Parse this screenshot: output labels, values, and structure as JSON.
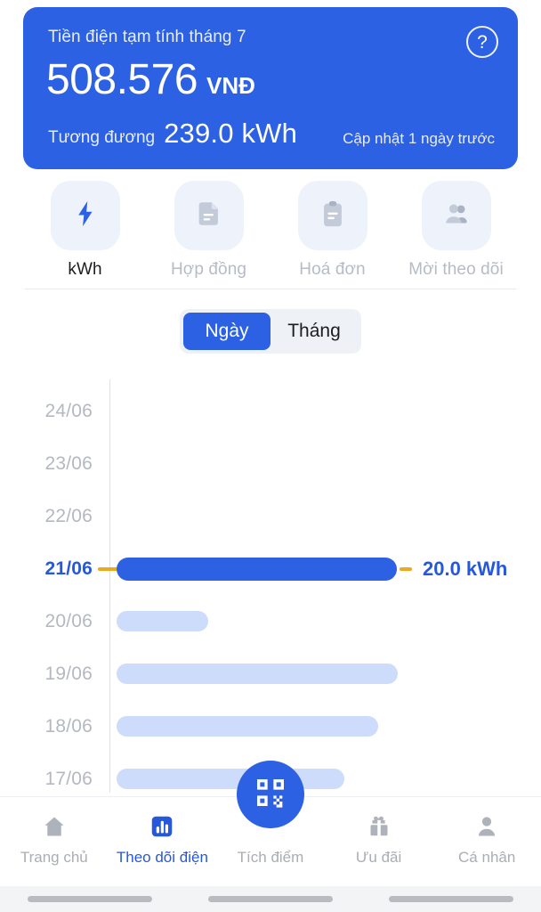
{
  "header": {
    "title": "Tiền điện tạm tính tháng 7",
    "amount": "508.576",
    "currency": "VNĐ",
    "equivalent_label": "Tương đương",
    "equivalent_value": "239.0 kWh",
    "updated": "Cập nhật 1 ngày trước",
    "help_icon": "question-circle-icon",
    "bg_color": "#2c61e4"
  },
  "quick_actions": [
    {
      "label": "kWh",
      "icon": "lightning-bolt-icon",
      "active": true
    },
    {
      "label": "Hợp đồng",
      "icon": "document-icon",
      "active": false
    },
    {
      "label": "Hoá đơn",
      "icon": "clipboard-icon",
      "active": false
    },
    {
      "label": "Mời theo dõi",
      "icon": "people-group-icon",
      "active": false
    }
  ],
  "segmented": {
    "options": [
      "Ngày",
      "Tháng"
    ],
    "selected": "Ngày"
  },
  "chart_data": {
    "type": "bar",
    "orientation": "horizontal",
    "title": "",
    "xlabel": "kWh",
    "ylabel": "",
    "categories": [
      "24/06",
      "23/06",
      "22/06",
      "21/06",
      "20/06",
      "19/06",
      "18/06",
      "17/06"
    ],
    "values": [
      0,
      0,
      0,
      20.0,
      6.9,
      20.1,
      18.7,
      16.3
    ],
    "selected_category": "21/06",
    "selected_value_label": "20.0 kWh",
    "xlim": [
      0,
      20.1
    ],
    "grid": false,
    "legend": false,
    "bar_color": "#ccdcfa",
    "selected_bar_color": "#2c61e4",
    "connector_color": "#eaa91e"
  },
  "bottom_nav": {
    "items": [
      {
        "label": "Trang chủ",
        "icon": "home-icon",
        "active": false
      },
      {
        "label": "Theo dõi điện",
        "icon": "bar-chart-icon",
        "active": true
      },
      {
        "label": "Tích điểm",
        "icon": "qr-code-icon",
        "active": false
      },
      {
        "label": "Ưu đãi",
        "icon": "gift-icon",
        "active": false
      },
      {
        "label": "Cá nhân",
        "icon": "person-icon",
        "active": false
      }
    ]
  },
  "colors": {
    "primary": "#2c61e4",
    "accent": "#eaa91e",
    "bar_light": "#ccdcfa",
    "muted_text": "#b4b8c0"
  }
}
